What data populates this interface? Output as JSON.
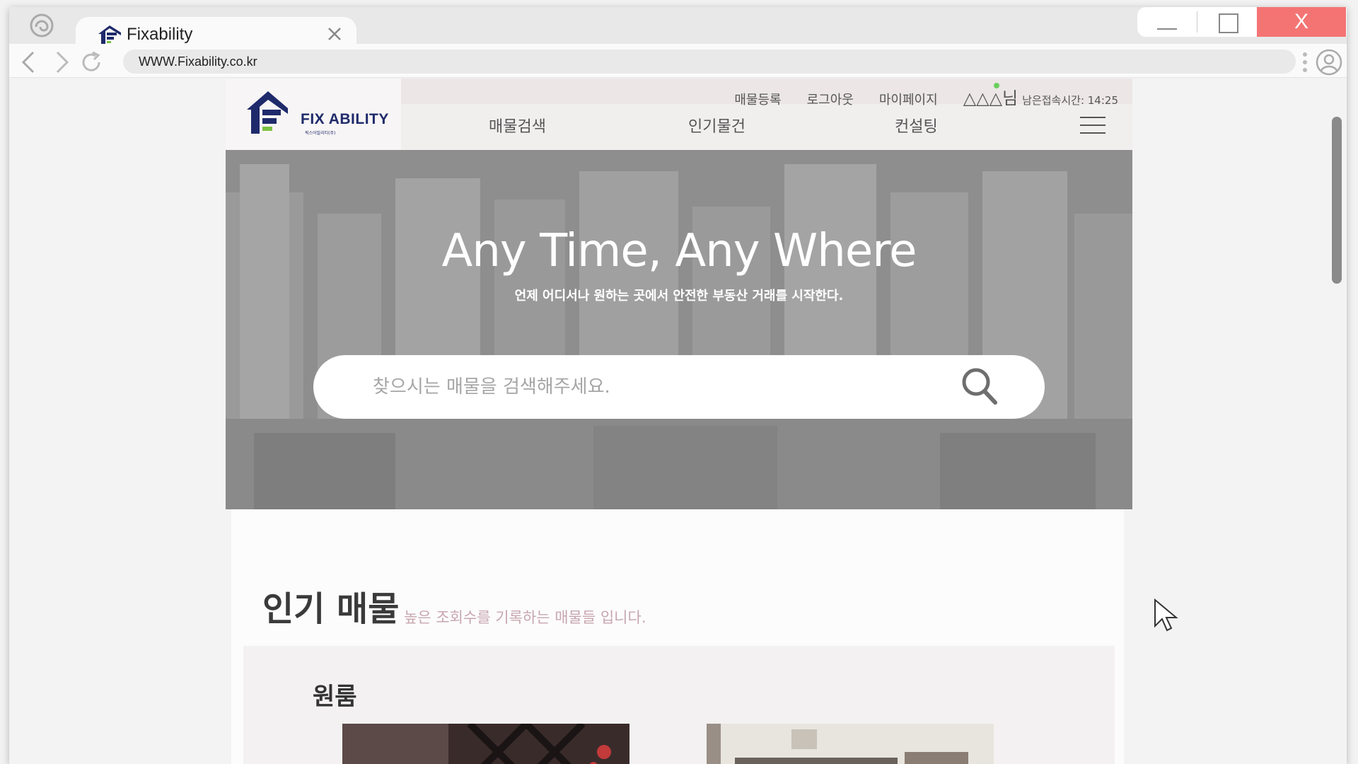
{
  "browser": {
    "tab_title": "Fixability",
    "url": "WWW.Fixability.co.kr",
    "close_label": "X"
  },
  "site": {
    "logo_text": "FIX ABILITY",
    "logo_subtext": "픽스어빌리티(주)",
    "util_links": [
      "매물등록",
      "로그아웃",
      "마이페이지"
    ],
    "user_name": "△△△님",
    "session_label": "남은접속시간: 14:25",
    "main_nav": [
      "매물검색",
      "인기물건",
      "컨설팅"
    ],
    "hero_title": "Any Time, Any Where",
    "hero_subtitle": "언제 어디서나 원하는 곳에서 안전한 부동산 거래를 시작한다.",
    "search_placeholder": "찾으시는 매물을 검색해주세요.",
    "popular_title": "인기 매물",
    "popular_subtitle": "높은 조회수를 기록하는 매물들 입니다.",
    "category_title": "원룸"
  },
  "colors": {
    "brand_navy": "#1f2a6b",
    "brand_green": "#7cc242",
    "close_red": "#f47474",
    "online_dot": "#6ccf5e",
    "accent_pink": "#c7a6b0"
  },
  "icons": [
    "app-swirl-icon",
    "back-arrow-icon",
    "forward-arrow-icon",
    "reload-icon",
    "close-icon",
    "more-vertical-icon",
    "profile-icon",
    "hamburger-menu-icon",
    "search-icon",
    "mouse-pointer-icon"
  ]
}
